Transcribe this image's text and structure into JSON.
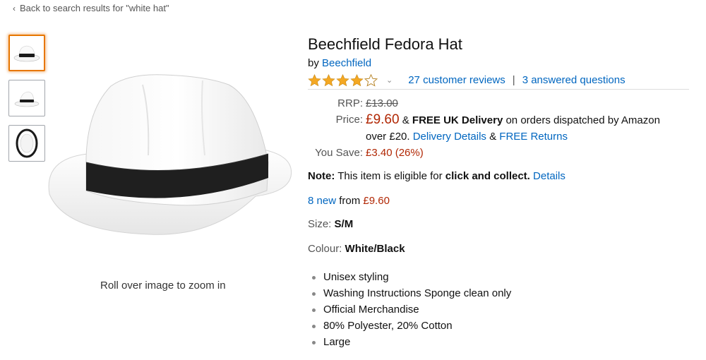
{
  "nav": {
    "back_text": "Back to search results for \"white hat\""
  },
  "gallery": {
    "thumbnails": [
      {
        "icon": "hat-front-thumbnail",
        "active": true
      },
      {
        "icon": "hat-side-thumbnail",
        "active": false
      },
      {
        "icon": "hat-top-thumbnail",
        "active": false
      }
    ],
    "zoom_hint": "Roll over image to zoom in"
  },
  "product": {
    "title": "Beechfield Fedora Hat",
    "by_label": "by",
    "brand": "Beechfield",
    "rating": 4,
    "reviews_text": "27 customer reviews",
    "separator": "|",
    "questions_text": "3 answered questions"
  },
  "pricing": {
    "rrp_label": "RRP:",
    "rrp_value": "£13.00",
    "price_label": "Price:",
    "price_value": "£9.60",
    "delivery_prefix": "&",
    "free_delivery": "FREE UK Delivery",
    "delivery_text_1": "on orders dispatched by Amazon",
    "delivery_text_2": "over £20.",
    "delivery_details_link": "Delivery Details",
    "amp": "&",
    "free_returns_link": "FREE Returns",
    "save_label": "You Save:",
    "save_value": "£3.40 (26%)"
  },
  "note": {
    "label": "Note:",
    "text": "This item is eligible for",
    "bold": "click and collect.",
    "link": "Details"
  },
  "offers": {
    "new_link": "8 new",
    "from_text": "from",
    "from_price": "£9.60"
  },
  "variants": {
    "size_label": "Size:",
    "size_value": "S/M",
    "colour_label": "Colour:",
    "colour_value": "White/Black"
  },
  "features": [
    "Unisex styling",
    "Washing Instructions Sponge clean only",
    "Official Merchandise",
    "80% Polyester, 20% Cotton",
    "Large"
  ],
  "colors": {
    "link": "#0066c0",
    "price": "#b12704",
    "star": "#f4a823",
    "active_thumb": "#e77600"
  }
}
